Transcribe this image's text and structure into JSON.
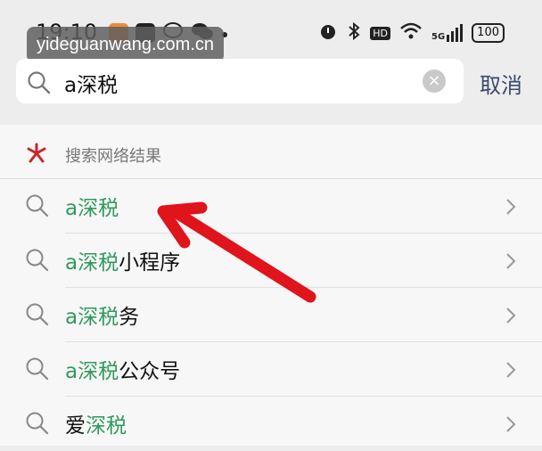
{
  "status_bar": {
    "time": "19:10",
    "battery": "100",
    "network": "5G",
    "hd": "HD"
  },
  "watermark": "yideguanwang.com.cn",
  "search": {
    "query": "a深税",
    "cancel_label": "取消"
  },
  "section": {
    "title": "搜索网络结果"
  },
  "results": [
    {
      "highlight": "a深税",
      "rest": "",
      "prefix": ""
    },
    {
      "highlight": "a深税",
      "rest": "小程序",
      "prefix": ""
    },
    {
      "highlight": "a深税",
      "rest": "务",
      "prefix": ""
    },
    {
      "highlight": "a深税",
      "rest": "公众号",
      "prefix": ""
    },
    {
      "prefix": "爱",
      "highlight": "深税",
      "rest": ""
    }
  ],
  "colors": {
    "highlight": "#2f9a5c",
    "annotation_arrow": "#e0141b",
    "cancel": "#3b4a6b"
  }
}
